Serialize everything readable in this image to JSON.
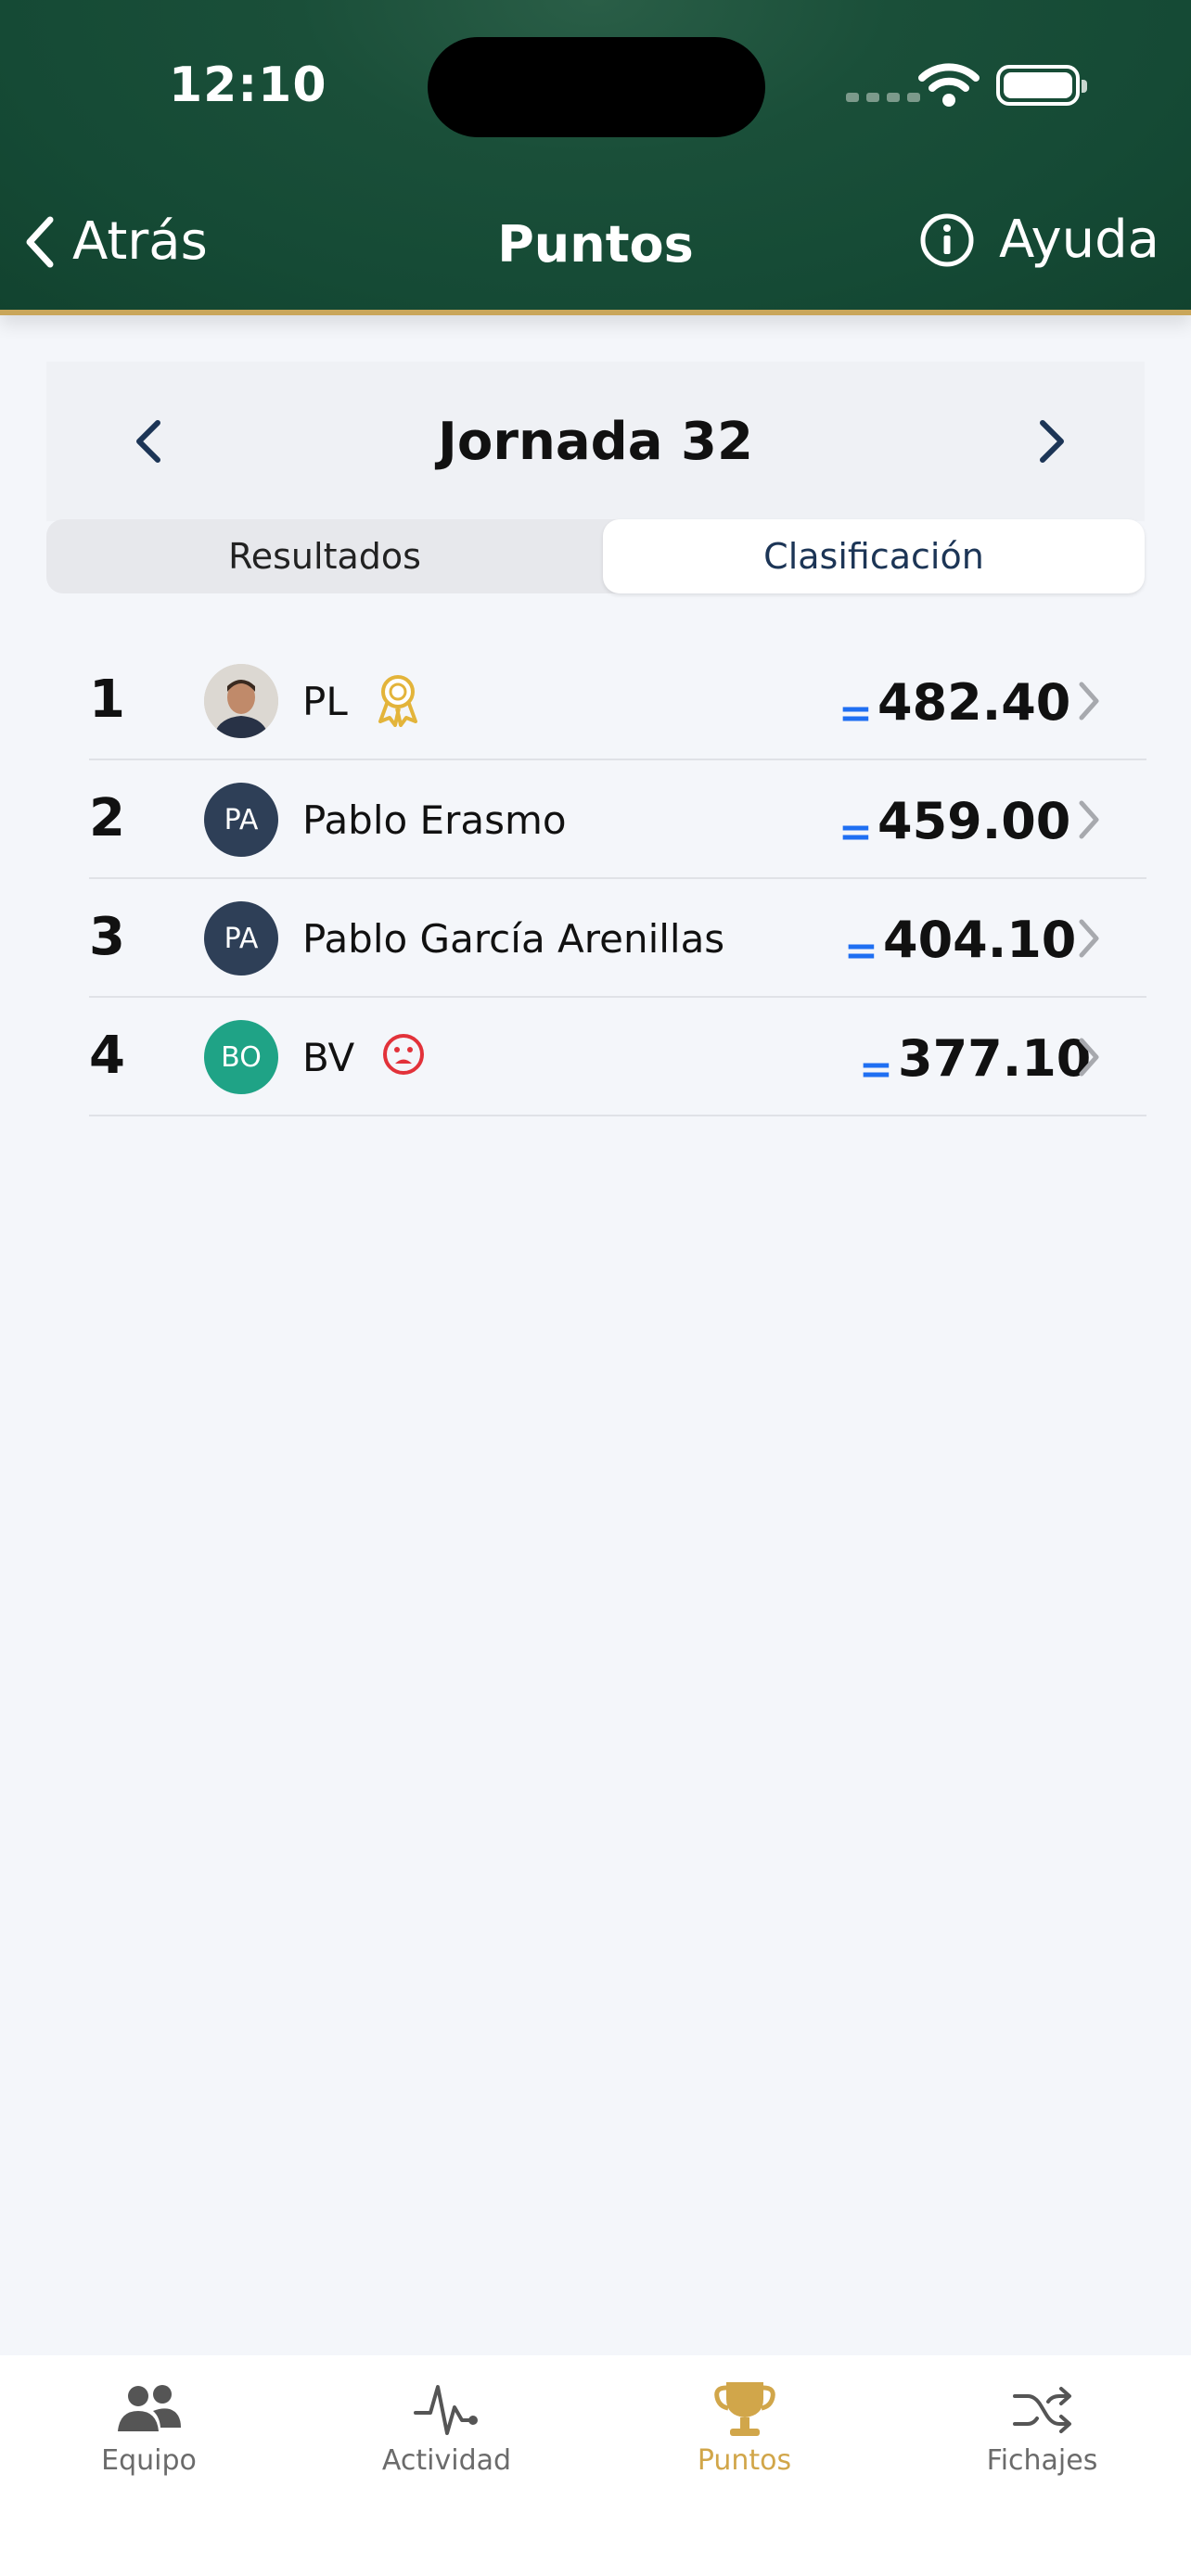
{
  "status_bar": {
    "time": "12:10"
  },
  "nav": {
    "back_label": "Atrás",
    "title": "Puntos",
    "help_label": "Ayuda"
  },
  "round": {
    "title": "Jornada 32"
  },
  "segments": {
    "left": "Resultados",
    "right": "Clasificación",
    "selected": "Clasificación"
  },
  "ranking": [
    {
      "rank": "1",
      "name": "PL",
      "initials": "",
      "avatar": "photo",
      "badge": "award-ribbon-icon",
      "change": "=",
      "points": "482.40"
    },
    {
      "rank": "2",
      "name": "Pablo Erasmo",
      "initials": "PA",
      "avatar_color": "#2e3f57",
      "badge": "",
      "change": "=",
      "points": "459.00"
    },
    {
      "rank": "3",
      "name": "Pablo García Arenillas",
      "initials": "PA",
      "avatar_color": "#2e3f57",
      "badge": "",
      "change": "=",
      "points": "404.10"
    },
    {
      "rank": "4",
      "name": "BV",
      "initials": "BO",
      "avatar_color": "#1fa386",
      "badge": "sad-face-icon",
      "change": "=",
      "points": "377.10"
    }
  ],
  "tabs": [
    {
      "label": "Equipo",
      "icon": "team-icon",
      "active": false
    },
    {
      "label": "Actividad",
      "icon": "activity-pulse-icon",
      "active": false
    },
    {
      "label": "Puntos",
      "icon": "trophy-icon",
      "active": true
    },
    {
      "label": "Fichajes",
      "icon": "shuffle-icon",
      "active": false
    }
  ],
  "colors": {
    "header_green": "#154a35",
    "gold_accent": "#d1a64a",
    "blue_accent": "#1f6ff2",
    "navy": "#1c3556"
  }
}
